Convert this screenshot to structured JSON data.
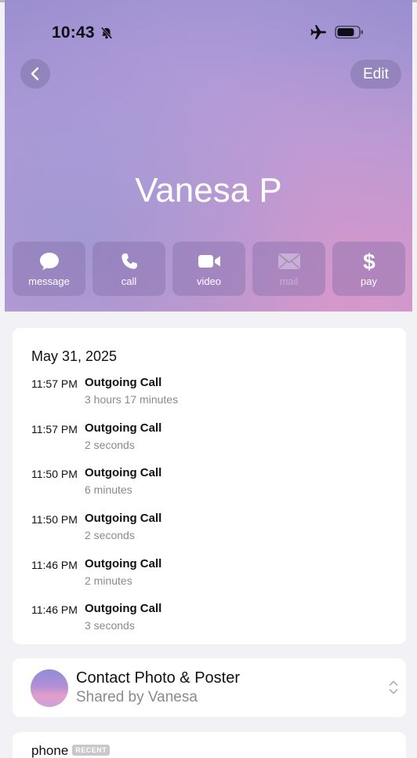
{
  "status_bar": {
    "time": "10:43"
  },
  "nav": {
    "edit_label": "Edit"
  },
  "contact": {
    "name": "Vanesa P"
  },
  "actions": [
    {
      "label": "message",
      "icon": "message-bubble-icon",
      "enabled": true
    },
    {
      "label": "call",
      "icon": "phone-icon",
      "enabled": true
    },
    {
      "label": "video",
      "icon": "video-camera-icon",
      "enabled": true
    },
    {
      "label": "mail",
      "icon": "mail-envelope-icon",
      "enabled": false
    },
    {
      "label": "pay",
      "icon": "dollar-icon",
      "enabled": true
    }
  ],
  "call_history": {
    "date": "May 31, 2025",
    "calls": [
      {
        "time": "11:57 PM",
        "type": "Outgoing Call",
        "duration": "3 hours 17 minutes"
      },
      {
        "time": "11:57 PM",
        "type": "Outgoing Call",
        "duration": "2 seconds"
      },
      {
        "time": "11:50 PM",
        "type": "Outgoing Call",
        "duration": "6 minutes"
      },
      {
        "time": "11:50 PM",
        "type": "Outgoing Call",
        "duration": "2 seconds"
      },
      {
        "time": "11:46 PM",
        "type": "Outgoing Call",
        "duration": "2 minutes"
      },
      {
        "time": "11:46 PM",
        "type": "Outgoing Call",
        "duration": "3 seconds"
      }
    ]
  },
  "contact_photo": {
    "title": "Contact Photo & Poster",
    "subtitle": "Shared by Vanesa"
  },
  "phone_section": {
    "label": "phone",
    "badge": "RECENT"
  },
  "colors": {
    "accent_header": "#b09ad6",
    "secondary_text": "#8a8a8e",
    "background": "#f2f1f6"
  }
}
